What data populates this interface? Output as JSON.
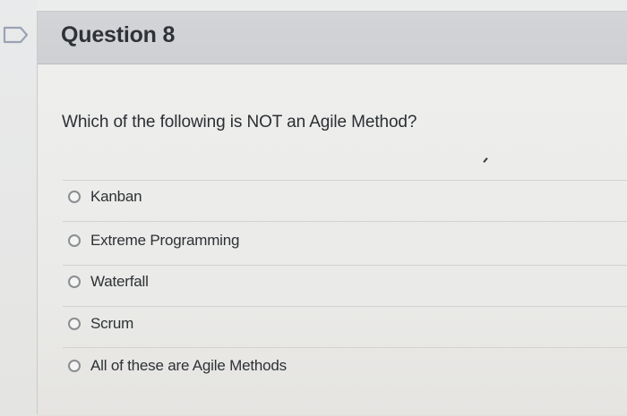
{
  "question": {
    "title": "Question 8",
    "text": "Which of the following is NOT an Agile Method?"
  },
  "options": [
    {
      "label": "Kanban"
    },
    {
      "label": "Extreme Programming"
    },
    {
      "label": "Waterfall"
    },
    {
      "label": "Scrum"
    },
    {
      "label": "All of these are Agile Methods"
    }
  ],
  "icons": {
    "flag": "flag-icon",
    "radio": "radio-unselected-icon"
  },
  "colors": {
    "header_bg": "#d0d1d4",
    "title_text": "#2f3338",
    "radio_border": "#8a8e92"
  }
}
